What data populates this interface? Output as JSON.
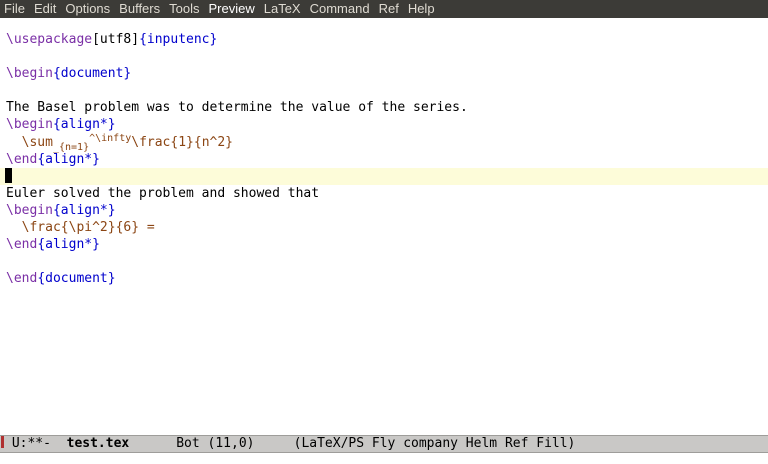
{
  "menu": [
    "File",
    "Edit",
    "Options",
    "Buffers",
    "Tools",
    "Preview",
    "LaTeX",
    "Command",
    "Ref",
    "Help"
  ],
  "editor": {
    "line1_cmd": "\\usepackage",
    "line1_opt": "[utf8]",
    "line1_arg": "{inputenc}",
    "line2_cmd": "\\begin",
    "line2_arg": "{document}",
    "line3_text": "The Basel problem was to determine the value of the series.",
    "line4_cmd": "\\begin",
    "line4_arg": "{align*}",
    "line5_a": "  \\sum",
    "line5_sub": "_{n=1}",
    "line5_sup": "^\\infty",
    "line5_b": "\\frac{1}{n^2}",
    "line6_cmd": "\\end",
    "line6_arg": "{align*}",
    "line8_text": "Euler solved the problem and showed that",
    "line9_cmd": "\\begin",
    "line9_arg": "{align*}",
    "line10_text": "  \\frac{\\pi^2}{6} =",
    "line11_cmd": "\\end",
    "line11_arg": "{align*}",
    "line13_cmd": "\\end",
    "line13_arg": "{document}"
  },
  "modeline": {
    "status": " U:**-  ",
    "filename": "test.tex",
    "position": "      Bot (11,0)     ",
    "modes": "(LaTeX/PS Fly company Helm Ref Fill)"
  }
}
